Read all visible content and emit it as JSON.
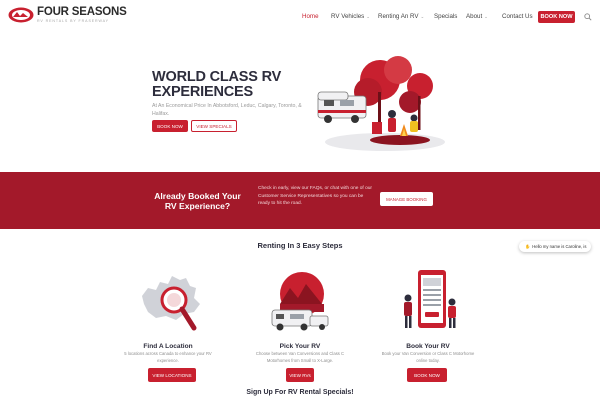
{
  "brand": {
    "name": "FOUR SEASONS",
    "tagline": "RV RENTALS BY FRASERWAY",
    "accent_color": "#c8202f",
    "banner_color": "#a3192a"
  },
  "nav": {
    "items": [
      {
        "label": "Home",
        "active": true
      },
      {
        "label": "RV Vehicles",
        "dropdown": true
      },
      {
        "label": "Renting An RV",
        "dropdown": true
      },
      {
        "label": "Specials"
      },
      {
        "label": "About",
        "dropdown": true
      },
      {
        "label": "Contact Us"
      }
    ],
    "book_label": "BOOK NOW",
    "search_icon": "search-icon"
  },
  "hero": {
    "title_line1": "WORLD CLASS RV",
    "title_line2": "EXPERIENCES",
    "subtitle": "At An Economical Price In Abbotsford, Leduc, Calgary, Toronto, & Halifax.",
    "book_label": "BOOK NOW",
    "specials_label": "VIEW SPECIALS"
  },
  "banner": {
    "title": "Already Booked Your RV Experience?",
    "text": "Check in early, view our FAQs, or chat with one of our Customer Service Representatives so you can be ready to hit the road.",
    "button_label": "MANAGE BOOKING"
  },
  "steps": {
    "heading": "Renting In 3 Easy Steps",
    "items": [
      {
        "title": "Find A Location",
        "desc": "5 locations across Canada to enhance your RV experience.",
        "button": "VIEW LOCATIONS"
      },
      {
        "title": "Pick Your RV",
        "desc": "Choose between Van Conversions and Class C Motorhomes from Small to X-Large.",
        "button": "VIEW RVs"
      },
      {
        "title": "Book Your RV",
        "desc": "Book your Van Conversion or Class C Motorhome online today.",
        "button": "BOOK NOW"
      }
    ]
  },
  "chat": {
    "label": "Hello my name is Caroline, is"
  },
  "signup": {
    "heading": "Sign Up For RV Rental Specials!"
  }
}
